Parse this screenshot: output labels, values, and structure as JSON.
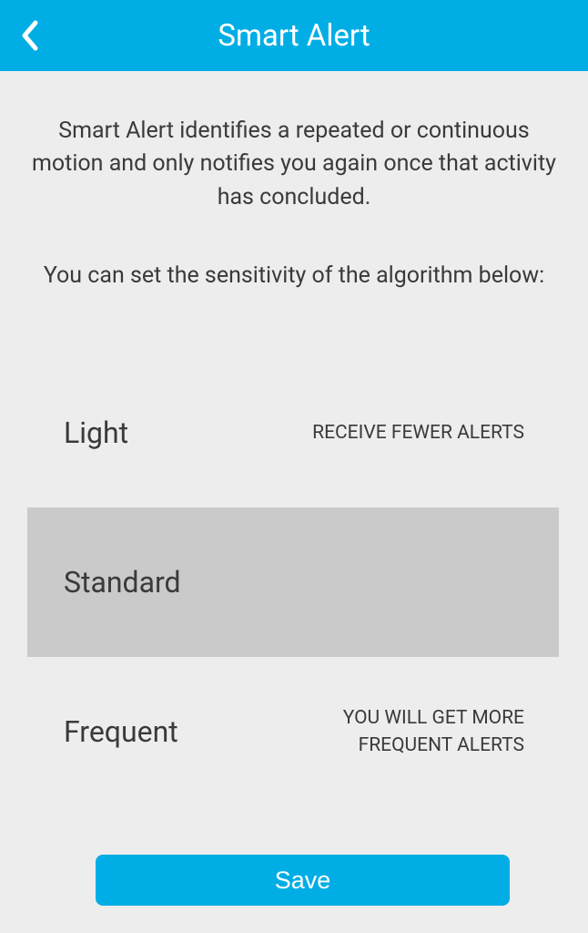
{
  "header": {
    "title": "Smart Alert"
  },
  "content": {
    "description": "Smart Alert identifies a repeated or continuous motion and only notifies you again once that activity has concluded.",
    "subdescription": "You can set the sensitivity of the algorithm below:"
  },
  "options": [
    {
      "label": "Light",
      "description": "RECEIVE FEWER ALERTS",
      "selected": false
    },
    {
      "label": "Standard",
      "description": "",
      "selected": true
    },
    {
      "label": "Frequent",
      "description": "YOU WILL GET MORE FREQUENT ALERTS",
      "selected": false
    }
  ],
  "footer": {
    "save_label": "Save"
  }
}
